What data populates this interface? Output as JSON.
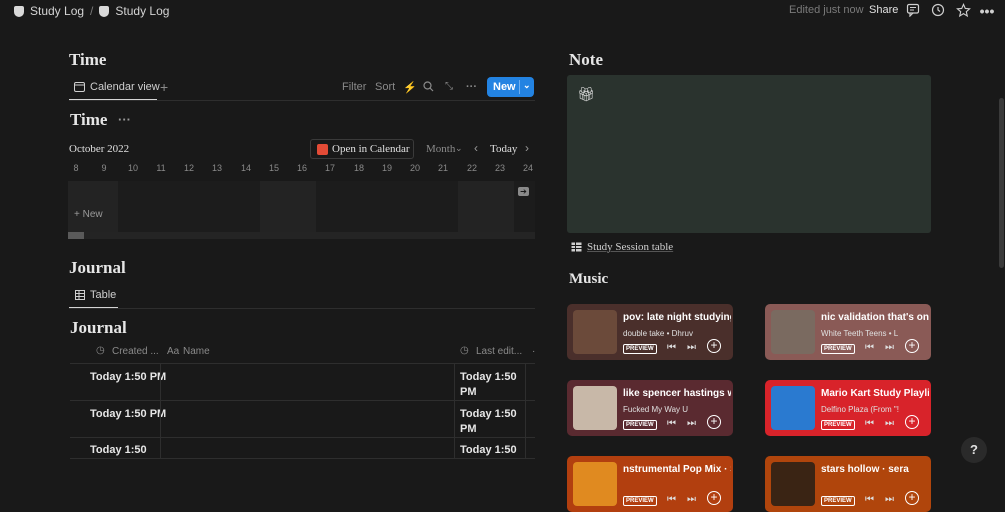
{
  "topbar": {
    "crumb1": "Study Log",
    "separator": "/",
    "crumb2": "Study Log",
    "edited": "Edited just now",
    "share": "Share"
  },
  "time_section": {
    "title": "Time",
    "view_tab": "Calendar view",
    "tools": {
      "filter": "Filter",
      "sort": "Sort"
    },
    "new_label": "New",
    "db_title": "Time",
    "month_label": "October 2022",
    "open_calendar": "Open in Calendar",
    "month_select": "Month",
    "today": "Today",
    "days": [
      "8",
      "9",
      "10",
      "11",
      "12",
      "13",
      "14",
      "15",
      "16",
      "17",
      "18",
      "19",
      "20",
      "21",
      "22",
      "23",
      "24"
    ],
    "new_item": "+ New"
  },
  "journal_section": {
    "title": "Journal",
    "view_tab": "Table",
    "db_title": "Journal",
    "columns": [
      "Created ...",
      "Name",
      "Last edit..."
    ],
    "rows": [
      {
        "created": "Today 1:50 PM",
        "name": "",
        "edited": "Today 1:50 PM"
      },
      {
        "created": "Today 1:50 PM",
        "name": "",
        "edited": "Today 1:50 PM"
      },
      {
        "created": "Today 1:50",
        "name": "",
        "edited": "Today 1:50"
      }
    ]
  },
  "note_section": {
    "title": "Note",
    "callout_icon": "gift-icon",
    "callout_color": "#2a332e",
    "linked_table": "Study Session table"
  },
  "music_section": {
    "title": "Music",
    "preview_label": "PREVIEW",
    "cards": [
      {
        "title": "pov: late night studying ·",
        "subtitle": "double take • Dhruv",
        "color": "#4a2f2b"
      },
      {
        "title": "nic validation that's only",
        "subtitle": "White Teeth Teens • L",
        "color": "#8a5a56"
      },
      {
        "title": "like spencer hastings wh",
        "subtitle": "Fucked My Way U",
        "color": "#5a2a30"
      },
      {
        "title": "Mario Kart Study Playlist",
        "subtitle": "Delfino Plaza (From \"!",
        "color": "#d8232a"
      },
      {
        "title": "nstrumental Pop Mix · Sp",
        "subtitle": "",
        "color": "#b23f0f"
      },
      {
        "title": "stars hollow · sera",
        "subtitle": "",
        "color": "#b0450c"
      }
    ]
  },
  "help": "?"
}
